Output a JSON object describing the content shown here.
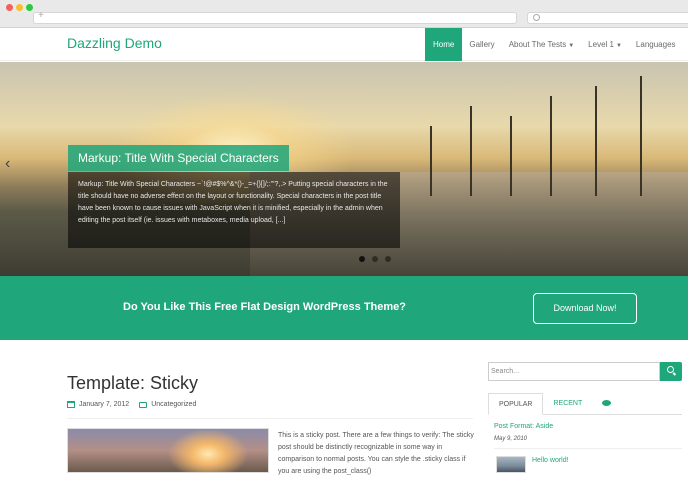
{
  "site": {
    "logo": "Dazzling Demo",
    "nav": [
      {
        "label": "Home",
        "active": true
      },
      {
        "label": "Gallery",
        "dropdown": false
      },
      {
        "label": "About The Tests",
        "dropdown": true
      },
      {
        "label": "Level 1",
        "dropdown": true
      },
      {
        "label": "Languages",
        "dropdown": false
      }
    ]
  },
  "hero": {
    "caption_title": "Markup: Title With Special Characters",
    "caption_body": "Markup: Title With Special Characters ~`!@#$%^&*()-_=+{}[]/;:'\"?,.> Putting special characters in the title should have no adverse effect on the layout or functionality. Special characters in the post title have been known to cause issues with JavaScript when it is minified, especially in the admin when editing the post itself (ie. issues with metaboxes, media upload, [...]",
    "slide_count": 3,
    "active_slide": 1
  },
  "cta": {
    "text": "Do You Like This Free Flat Design WordPress Theme?",
    "button": "Download Now!"
  },
  "post": {
    "title": "Template: Sticky",
    "date": "January 7, 2012",
    "category": "Uncategorized",
    "excerpt": "This is a sticky post. There are a few things to verify: The sticky post should be distinctly recognizable in some way in comparison to normal posts. You can style the .sticky class if you are using the post_class()"
  },
  "sidebar": {
    "search_placeholder": "Search...",
    "tabs": [
      "POPULAR",
      "RECENT"
    ],
    "popular": [
      {
        "title": "Post Format: Aside",
        "date": "May 9, 2010"
      },
      {
        "title": "Hello world!"
      }
    ]
  },
  "colors": {
    "accent": "#1fa67a"
  }
}
